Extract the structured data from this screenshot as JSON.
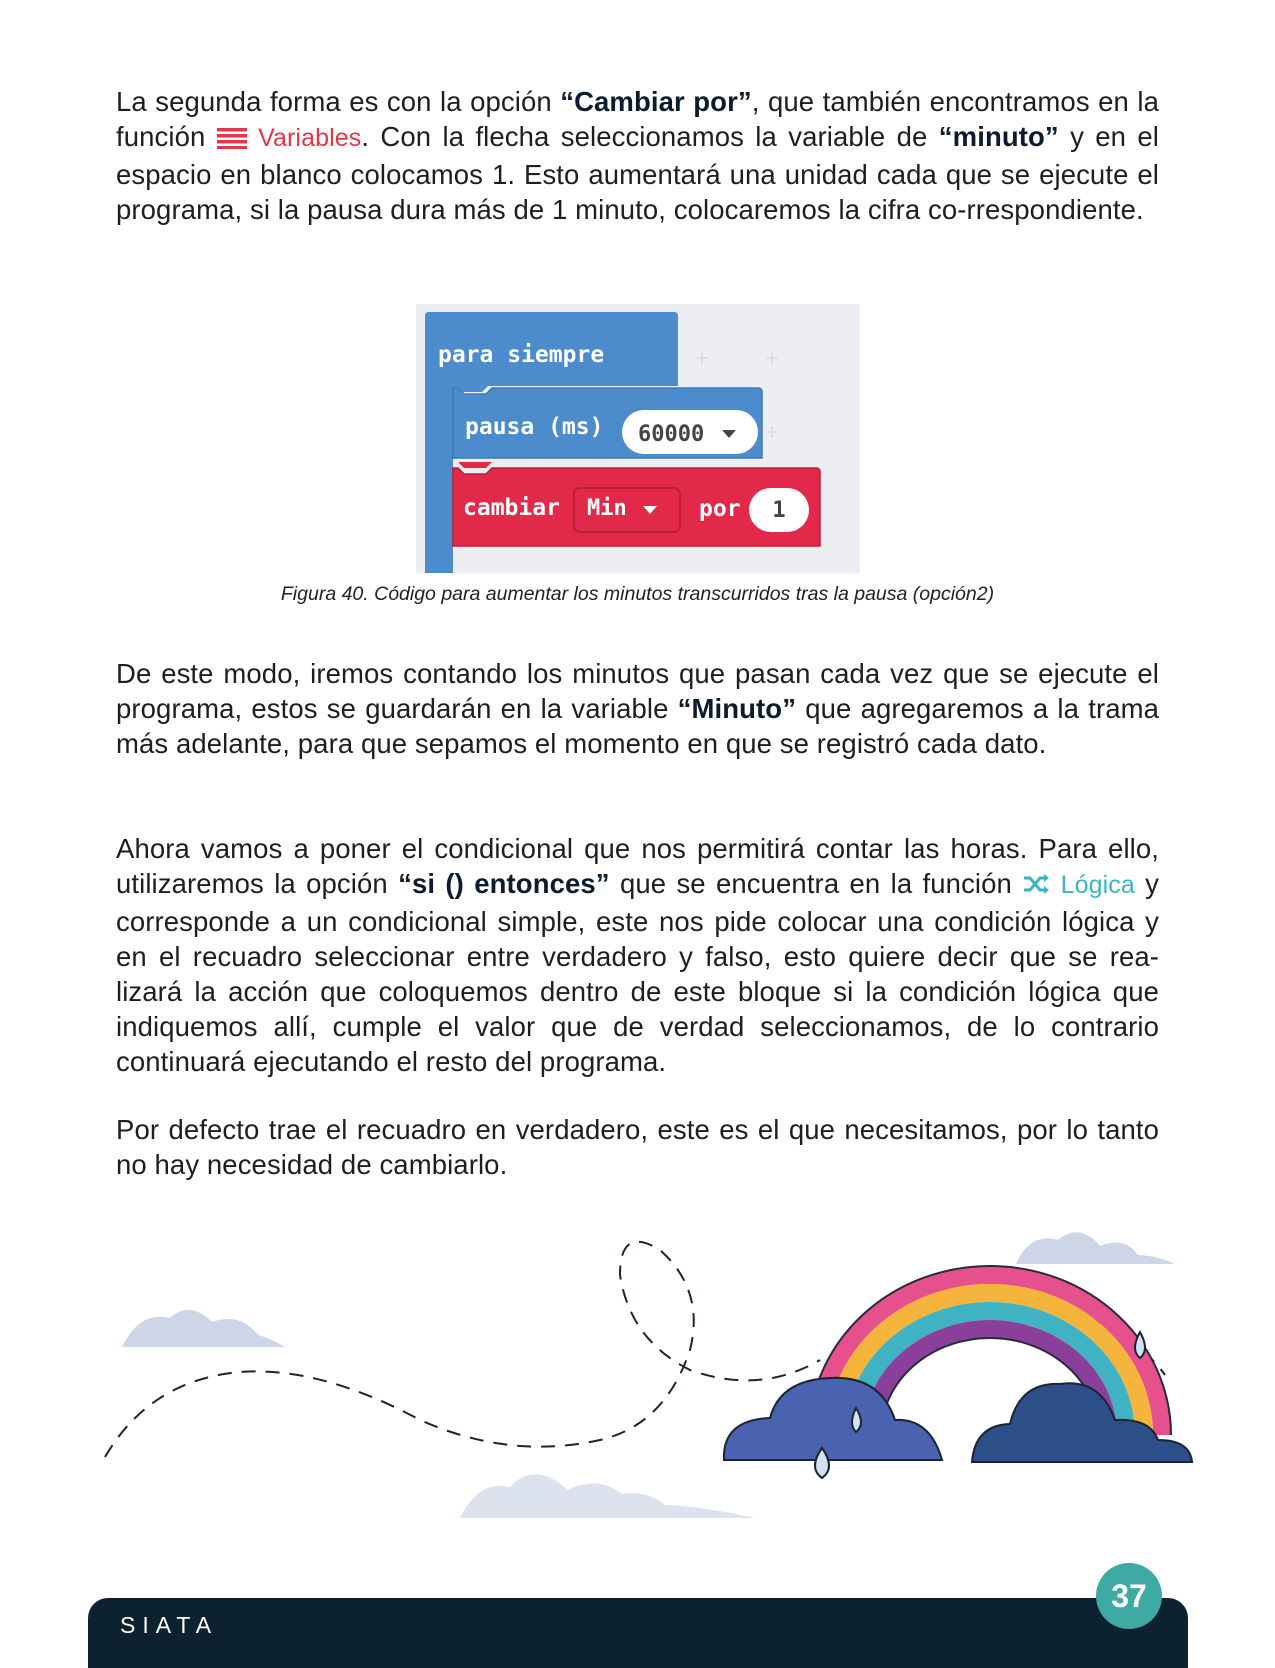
{
  "para1": {
    "t1": "La segunda forma es con la opción ",
    "b1": "“Cambiar por”",
    "t2": ", que también encontramos en la función ",
    "chip": "Variables",
    "t3": ". Con la flecha seleccionamos la variable de ",
    "b2": "“minuto”",
    "t4": " y en el espacio en blanco colocamos 1. Esto aumentará una unidad cada que se ejecute el programa, si la pausa dura más de 1 minuto, colocaremos la cifra co-rrespondiente."
  },
  "figure": {
    "forever_label": "para siempre",
    "pause_label": "pausa (ms)",
    "pause_value": "60000",
    "change_label": "cambiar",
    "variable": "Min",
    "by_label": "por",
    "by_value": "1"
  },
  "caption": "Figura 40. Código para aumentar los minutos transcurridos tras la pausa (opción2)",
  "para2": {
    "t1": "De este modo, iremos contando los minutos que pasan cada vez que se ejecute el programa, estos se guardarán en la variable ",
    "b1": "“Minuto”",
    "t2": " que agregaremos a la trama más adelante, para que sepamos el momento en que se registró cada dato."
  },
  "para3": {
    "t1": "Ahora vamos a poner el condicional que nos permitirá contar las horas. Para ello, utilizaremos la opción ",
    "b1": "“si () entonces”",
    "t2": " que se encuentra en la función ",
    "chip": "Lógica",
    "t3": " y corresponde a un condicional simple, este nos pide colocar una condición lógica y en el recuadro seleccionar entre verdadero y falso, esto quiere decir que se rea-lizará la acción que coloquemos dentro de este bloque si la condición lógica que indiquemos allí, cumple el valor que de verdad seleccionamos, de lo contrario continuará ejecutando el resto del programa."
  },
  "para4": "Por defecto trae el recuadro en verdadero, este es el que necesitamos, por lo tanto no hay necesidad de cambiarlo.",
  "footer": {
    "brand": "SIATA",
    "page_number": "37"
  },
  "colors": {
    "variables_red": "#e0374b",
    "logic_teal": "#39b5c2",
    "block_blue": "#4c8ccd",
    "block_red": "#e2294a",
    "footer_navy": "#0d2230",
    "page_badge": "#3fa9a3"
  },
  "icons": [
    "variables-list-icon",
    "logic-shuffle-icon",
    "rainbow-illustration",
    "cloud-illustration"
  ]
}
